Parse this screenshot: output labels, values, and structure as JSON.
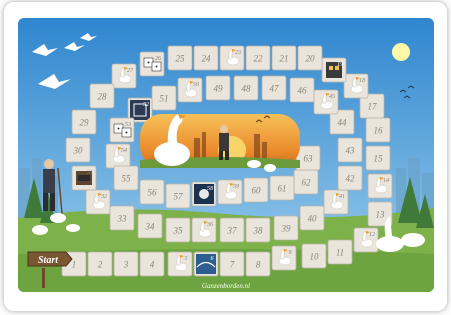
{
  "board": {
    "website": "Ganzenborden.nl",
    "start_label": "Start",
    "squares": [
      {
        "n": "1"
      },
      {
        "n": "2"
      },
      {
        "n": "3"
      },
      {
        "n": "4"
      },
      {
        "n": "5",
        "icon": "goose-icon"
      },
      {
        "n": "6",
        "icon": "bridge-icon"
      },
      {
        "n": "7"
      },
      {
        "n": "8"
      },
      {
        "n": "9",
        "icon": "goose-icon"
      },
      {
        "n": "10"
      },
      {
        "n": "11"
      },
      {
        "n": "12",
        "icon": "goose-icon"
      },
      {
        "n": "13"
      },
      {
        "n": "14",
        "icon": "goose-icon"
      },
      {
        "n": "15"
      },
      {
        "n": "16"
      },
      {
        "n": "17"
      },
      {
        "n": "18",
        "icon": "goose-icon"
      },
      {
        "n": "19",
        "icon": "inn-icon"
      },
      {
        "n": "20"
      },
      {
        "n": "21"
      },
      {
        "n": "22"
      },
      {
        "n": "23",
        "icon": "goose-icon"
      },
      {
        "n": "24"
      },
      {
        "n": "25"
      },
      {
        "n": "26",
        "icon": "dice-icon"
      },
      {
        "n": "27",
        "icon": "goose-icon"
      },
      {
        "n": "28"
      },
      {
        "n": "29"
      },
      {
        "n": "30"
      },
      {
        "n": "31",
        "icon": "well-icon"
      },
      {
        "n": "32",
        "icon": "goose-icon"
      },
      {
        "n": "33"
      },
      {
        "n": "34"
      },
      {
        "n": "35"
      },
      {
        "n": "36",
        "icon": "goose-icon"
      },
      {
        "n": "37"
      },
      {
        "n": "38"
      },
      {
        "n": "39"
      },
      {
        "n": "40"
      },
      {
        "n": "41",
        "icon": "goose-icon"
      },
      {
        "n": "42"
      },
      {
        "n": "43"
      },
      {
        "n": "44"
      },
      {
        "n": "45",
        "icon": "goose-icon"
      },
      {
        "n": "46"
      },
      {
        "n": "47"
      },
      {
        "n": "48"
      },
      {
        "n": "49"
      },
      {
        "n": "50",
        "icon": "goose-icon"
      },
      {
        "n": "51"
      },
      {
        "n": "52",
        "icon": "maze-icon"
      },
      {
        "n": "53",
        "icon": "dice-icon"
      },
      {
        "n": "54",
        "icon": "goose-icon"
      },
      {
        "n": "55"
      },
      {
        "n": "56"
      },
      {
        "n": "57"
      },
      {
        "n": "58",
        "icon": "skull-icon"
      },
      {
        "n": "59",
        "icon": "goose-icon"
      },
      {
        "n": "60"
      },
      {
        "n": "61"
      },
      {
        "n": "62"
      },
      {
        "n": "63"
      }
    ]
  },
  "colors": {
    "sky": "#3b8fd1",
    "grass": "#7db24a",
    "path": "#e9e5dc",
    "square_border": "#b9b2a4",
    "number": "#8a8373",
    "sunset": "#f2a23a",
    "night": "#1b3150",
    "bridge_square": "#2e5e90"
  }
}
